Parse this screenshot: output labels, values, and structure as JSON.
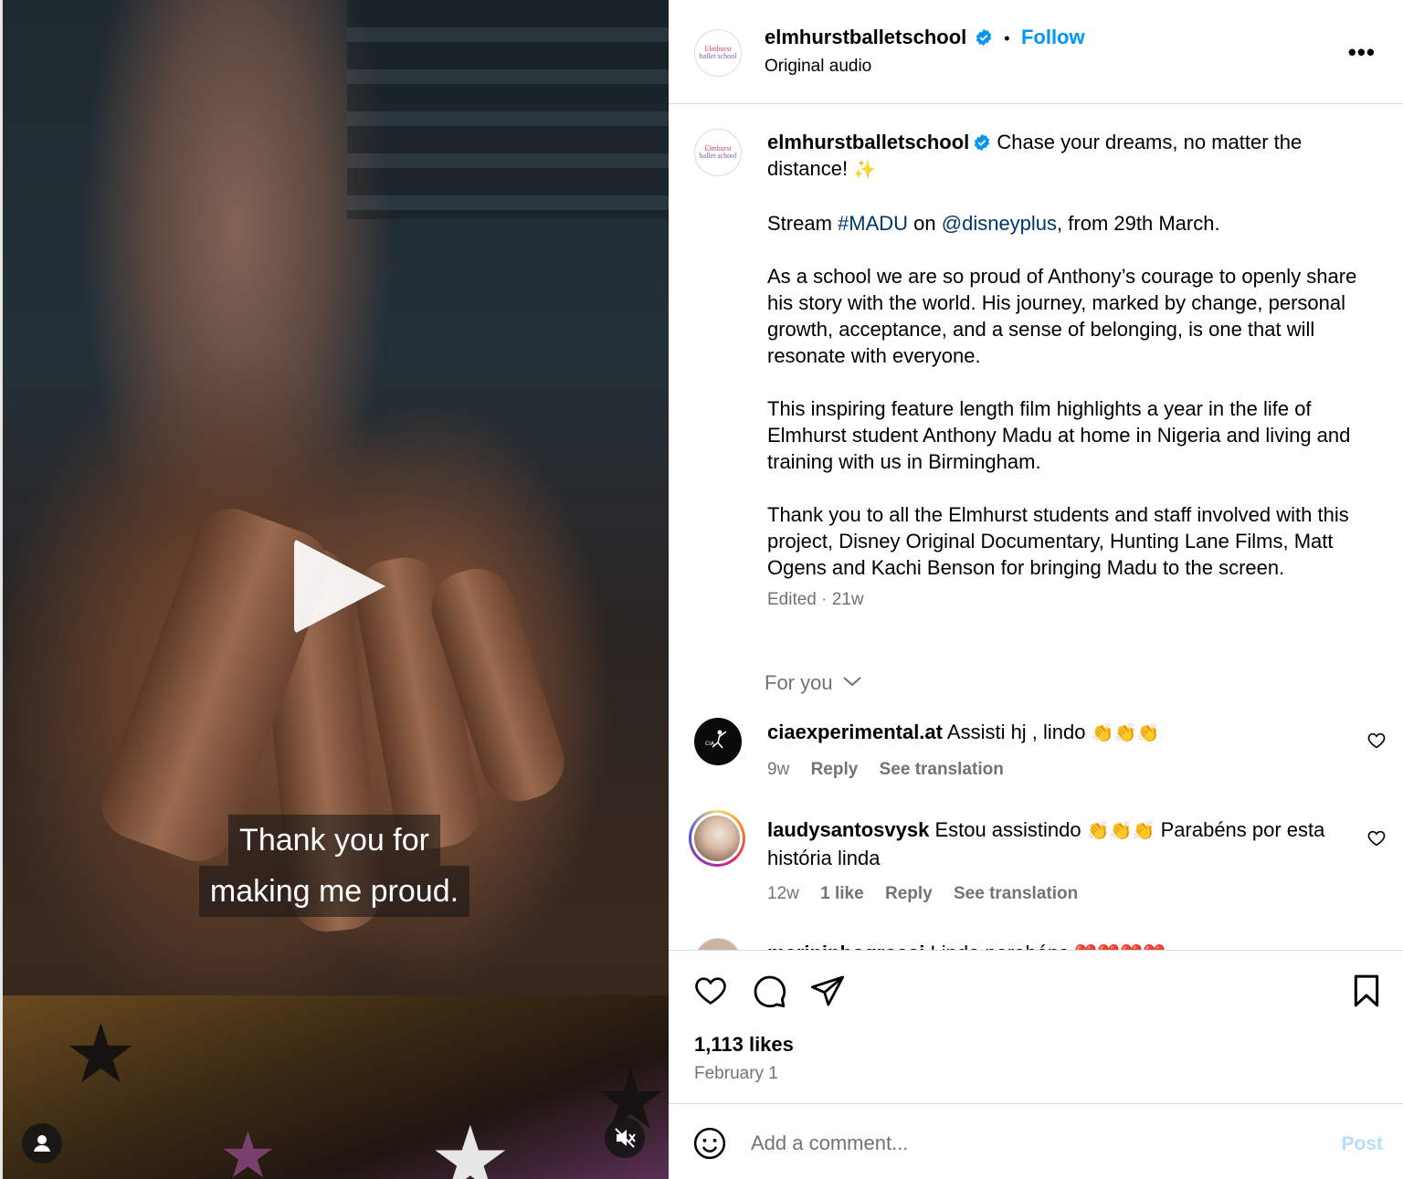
{
  "video": {
    "subtitle_line1": "Thank you for",
    "subtitle_line2": "making me proud."
  },
  "header": {
    "username": "elmhurstballetschool",
    "follow_label": "Follow",
    "audio_label": "Original audio",
    "avatar_text": "Elmhurst ballet school"
  },
  "caption": {
    "username": "elmhurstballetschool",
    "line1_text": "Chase your dreams, no matter the distance!",
    "sparkle": "✨",
    "stream_prefix": "Stream ",
    "hashtag": "#MADU",
    "on": " on ",
    "mention": "@disneyplus",
    "stream_suffix": ", from 29th March.",
    "para2": "As a school we are so proud of Anthony’s courage to openly share his story with the world. His journey, marked by change, personal growth, acceptance, and a sense of belonging, is one that will resonate with everyone.",
    "para3": "This inspiring feature length film highlights a year in the life of Elmhurst student Anthony Madu at home in Nigeria and living and training with us in Birmingham.",
    "para4": "Thank you to all the Elmhurst students and staff involved with this project, Disney Original Documentary, Hunting Lane Films, Matt Ogens and Kachi Benson for bringing Madu to the screen.",
    "edited": "Edited",
    "time": "21w"
  },
  "for_you_label": "For you",
  "comments": [
    {
      "username": "ciaexperimental.at",
      "text": "Assisti hj , lindo",
      "emoji": "👏👏👏",
      "time": "9w",
      "reply": "Reply",
      "see_translation": "See translation"
    },
    {
      "username": "laudysantosvysk",
      "text_a": "Estou assistindo",
      "emoji": "👏👏👏",
      "text_b": "Parabéns por esta história linda",
      "time": "12w",
      "likes": "1 like",
      "reply": "Reply",
      "see_translation": "See translation"
    },
    {
      "username": "marininhogrossi",
      "text": "Lindo parabéns",
      "emoji": "❤️❤️❤️❤️"
    }
  ],
  "likes": "1,113 likes",
  "date": "February 1",
  "composer": {
    "placeholder": "Add a comment...",
    "post_label": "Post"
  },
  "colors": {
    "link_blue": "#0095f6",
    "verified_blue": "#0095f6",
    "secondary_text": "#737373",
    "border": "#dbdbdb"
  }
}
